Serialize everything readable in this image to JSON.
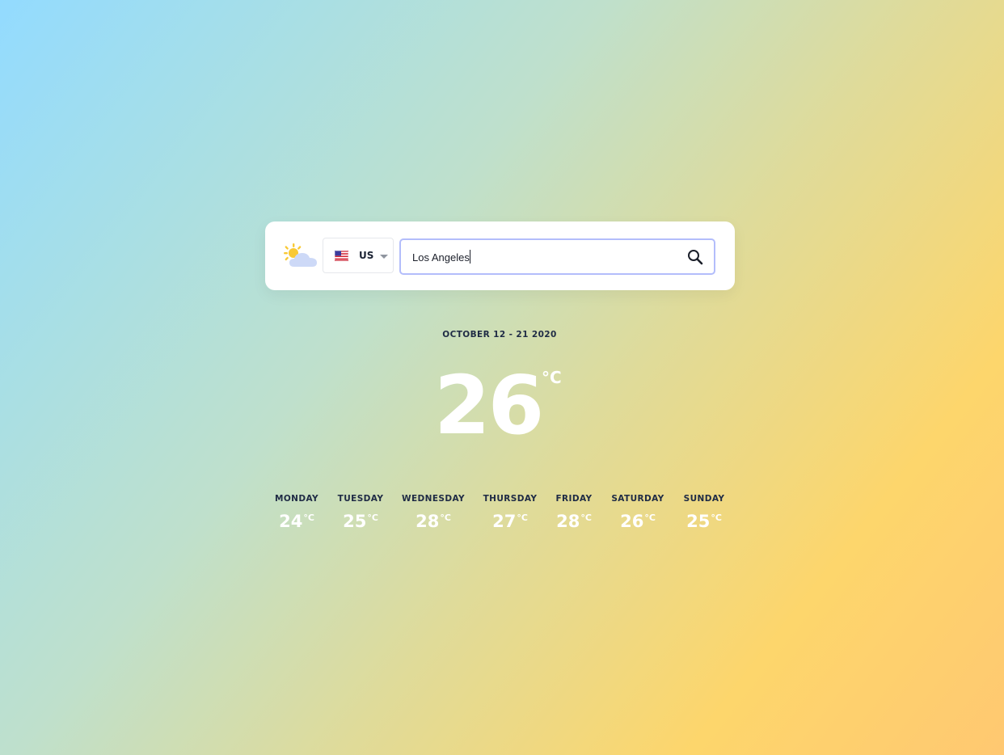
{
  "search": {
    "country_code": "US",
    "city_value": "Los Angeles",
    "city_placeholder": ""
  },
  "date_range": "OCTOBER 12 - 21 2020",
  "current": {
    "temperature": "26",
    "unit": "°C"
  },
  "forecast": [
    {
      "day": "MONDAY",
      "temp": "24",
      "unit": "°C"
    },
    {
      "day": "TUESDAY",
      "temp": "25",
      "unit": "°C"
    },
    {
      "day": "WEDNESDAY",
      "temp": "28",
      "unit": "°C"
    },
    {
      "day": "THURSDAY",
      "temp": "27",
      "unit": "°C"
    },
    {
      "day": "FRIDAY",
      "temp": "28",
      "unit": "°C"
    },
    {
      "day": "SATURDAY",
      "temp": "26",
      "unit": "°C"
    },
    {
      "day": "SUNDAY",
      "temp": "25",
      "unit": "°C"
    }
  ],
  "icons": {
    "logo": "sun-behind-cloud-icon",
    "flag": "us-flag-icon",
    "dropdown": "chevron-down-icon",
    "search": "search-icon"
  },
  "colors": {
    "input_border": "#b3bdfb",
    "text_dark": "#1f2b45",
    "temperature": "#ffffff"
  }
}
